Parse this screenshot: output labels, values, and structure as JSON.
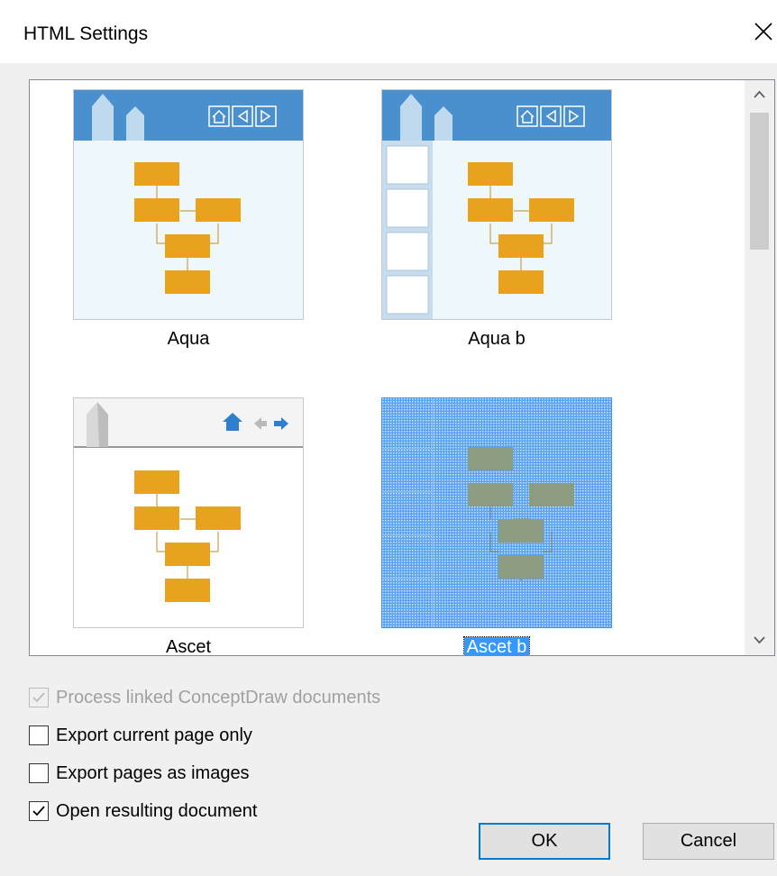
{
  "window": {
    "title": "HTML Settings"
  },
  "templates": [
    {
      "label": "Aqua",
      "selected": false
    },
    {
      "label": "Aqua b",
      "selected": false
    },
    {
      "label": "Ascet",
      "selected": false
    },
    {
      "label": "Ascet b",
      "selected": true
    }
  ],
  "options": [
    {
      "label": "Process linked ConceptDraw documents",
      "checked": true,
      "disabled": true
    },
    {
      "label": "Export current page only",
      "checked": false,
      "disabled": false
    },
    {
      "label": "Export pages as images",
      "checked": false,
      "disabled": false
    },
    {
      "label": "Open resulting document",
      "checked": true,
      "disabled": false
    }
  ],
  "buttons": {
    "ok": "OK",
    "cancel": "Cancel"
  },
  "colors": {
    "accent": "#0078d7",
    "selection": "#3399ff",
    "header_blue": "#4a90cf",
    "node_orange": "#e8a21d"
  }
}
